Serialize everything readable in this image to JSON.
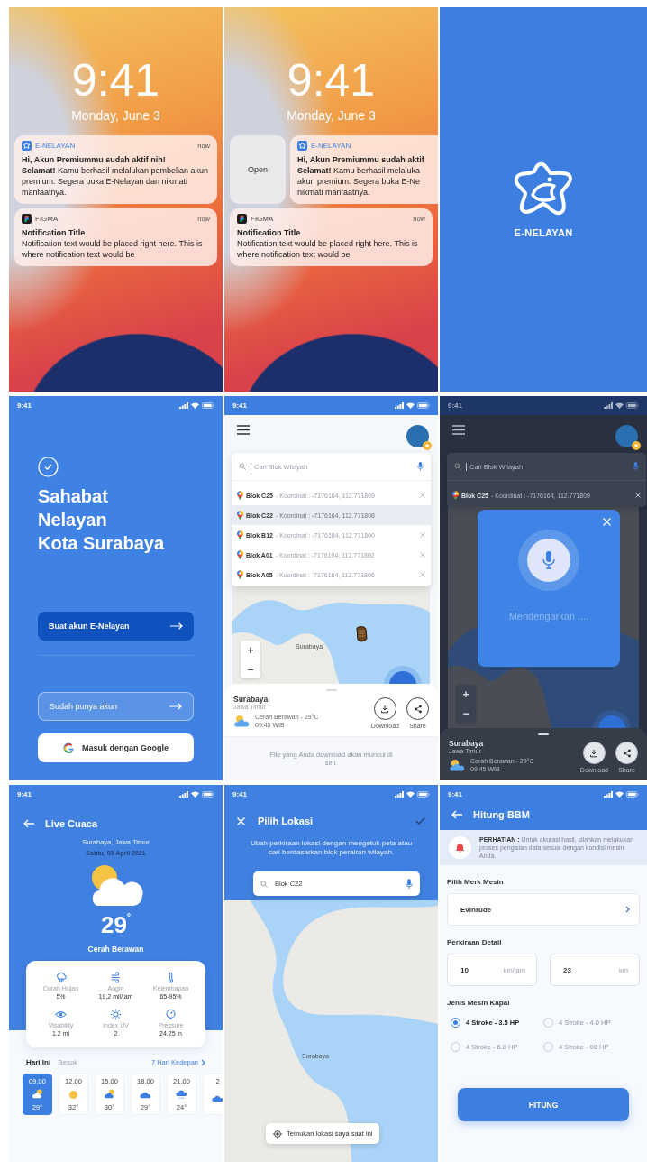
{
  "lock_screens": [
    {
      "time": "9:41",
      "date": "Monday, June 3",
      "notifications": [
        {
          "kind": "e-nelayan",
          "app": "E-NELAYAN",
          "time": "now",
          "title": "Hi, Akun Premiummu sudah aktif nih!",
          "body": "**Selamat!** Kamu berhasil melalukan pembelian akun premium. Segera buka E-Nelayan dan nikmati manfaatnya.",
          "swiped": false
        },
        {
          "kind": "figma",
          "app": "FIGMA",
          "time": "now",
          "title": "Notification Title",
          "body": "Notification text would be placed right here. This is where notification text would be",
          "swiped": false
        }
      ]
    },
    {
      "time": "9:41",
      "date": "Monday, June 3",
      "notifications": [
        {
          "kind": "e-nelayan",
          "app": "E-NELAYAN",
          "title": "Hi, Akun Premiummu sudah aktif",
          "body_lines": [
            "**Selamat!** Kamu berhasil melaluka",
            "akun premium. Segera buka E-Ne",
            "nikmati manfaatnya."
          ],
          "swiped": true,
          "action": "Open"
        },
        {
          "kind": "figma",
          "app": "FIGMA",
          "time": "now",
          "title": "Notification Title",
          "body": "Notification text would be placed right here. This is where notification text would be",
          "swiped": false
        }
      ]
    }
  ],
  "splash": {
    "brand": "E-NELAYAN"
  },
  "onboarding": {
    "time": "9:41",
    "title_lines": [
      "Sahabat",
      "Nelayan",
      "Kota Surabaya"
    ],
    "buttons": [
      {
        "kind": "primary",
        "label": "Buat akun E-Nelayan"
      },
      {
        "kind": "outline",
        "label": "Sudah punya akun"
      },
      {
        "kind": "google",
        "label": "Masuk dengan Google"
      }
    ]
  },
  "map_screen": {
    "time": "9:41",
    "search": {
      "placeholder": "Cari Blok Wilayah"
    },
    "results": [
      {
        "name": "Blok C25",
        "coords": "- Koordinat : -7176164, 112.771809",
        "selected": false
      },
      {
        "name": "Blok C22",
        "coords": "- Koordinat : -7176164, 112.771808",
        "selected": true
      },
      {
        "name": "Blok B12",
        "coords": "- Koordinat : -7176184, 112.771800",
        "selected": false
      },
      {
        "name": "Blok A01",
        "coords": "- Koordinat : -7176104, 112.771802",
        "selected": false
      },
      {
        "name": "Blok A05",
        "coords": "- Koordinat : -7176164, 112.771806",
        "selected": false
      }
    ],
    "map_labels": [
      "Surabaya"
    ],
    "zoom_controls": [
      "+",
      "−"
    ],
    "location": {
      "city": "Surabaya",
      "region": "Jawa Timur",
      "weather": "Cerah Berawan - 29°C",
      "time": "09.45 WIB"
    },
    "actions": [
      {
        "kind": "download",
        "label": "Download"
      },
      {
        "kind": "share",
        "label": "Share"
      }
    ],
    "note": "File yang Anda download akan muncul di sini."
  },
  "voice_screen": {
    "background": {
      "time": "9:41",
      "search": {
        "placeholder": "Cari Blok Wilayah"
      },
      "results": [
        {
          "name": "Blok C25",
          "coords": "- Koordinat : -7176164, 112.771809",
          "selected": false
        }
      ],
      "zoom_controls": [
        "+",
        "−"
      ],
      "location": {
        "city": "Surabaya",
        "region": "Jawa Timur",
        "weather": "Cerah Berawan - 29°C",
        "time": "09.45 WIB"
      },
      "actions": [
        {
          "kind": "download",
          "label": "Download"
        },
        {
          "kind": "share",
          "label": "Share"
        }
      ]
    },
    "modal": {
      "status": "Mendengarkan ...."
    }
  },
  "weather": {
    "time": "9:41",
    "title": "Live Cuaca",
    "location": "Surabaya, Jawa Timur",
    "date": "Sabtu, 03 April 2021",
    "temperature": "29",
    "degree": "°",
    "condition": "Cerah Berawan",
    "stats": [
      {
        "kind": "rain",
        "label": "Curah Hujan",
        "value": "5%"
      },
      {
        "kind": "wind",
        "label": "Angin",
        "value": "19,2 mil/jam"
      },
      {
        "kind": "humidity",
        "label": "Kelembapan",
        "value": "65-95%"
      },
      {
        "kind": "visibility",
        "label": "Visability",
        "value": "1.2 mi"
      },
      {
        "kind": "uv",
        "label": "Index UV",
        "value": "2"
      },
      {
        "kind": "pressure",
        "label": "Pressure",
        "value": "24.25 in"
      }
    ],
    "tabs": [
      {
        "label": "Hari Ini",
        "selected": true
      },
      {
        "label": "Besok",
        "selected": false
      }
    ],
    "more_link": "7 Hari Kedepan",
    "hourly": [
      {
        "time": "09.00",
        "kind": "partly-cloudy",
        "temp": "29°",
        "selected": true
      },
      {
        "time": "12.00",
        "kind": "sun",
        "temp": "32°",
        "selected": false
      },
      {
        "time": "15.00",
        "kind": "partly-cloudy",
        "temp": "30°",
        "selected": false
      },
      {
        "time": "18.00",
        "kind": "cloud",
        "temp": "29°",
        "selected": false
      },
      {
        "time": "21.00",
        "kind": "rain",
        "temp": "24°",
        "selected": false
      },
      {
        "time": "2",
        "kind": "cloud",
        "selected": false
      }
    ]
  },
  "pick_location": {
    "time": "9:41",
    "title": "Pilih Lokasi",
    "description": "Ubah perkiraan lokasi dengan mengetuk peta atau cari berdasarkan blok perairan wilayah.",
    "search": {
      "value": "Blok C22"
    },
    "map_labels": [
      "Surabaya"
    ],
    "locate_button": "Temukan lokasi saya saat ini"
  },
  "fuel": {
    "time": "9:41",
    "title": "Hitung BBM",
    "notice": "**PERHATIAN :** Untuk akurasi hasil, silahkan melakukan proses pengisian data sesuai dengan kondisi mesin Anda.",
    "brand_label": "Pilih Merk Mesin",
    "brand_value": "Evinrude",
    "detail_label": "Perkiraan Detail",
    "fields": [
      {
        "value": "10",
        "unit": "km/jam"
      },
      {
        "value": "23",
        "unit": "km"
      }
    ],
    "engine_label": "Jenis Mesin Kapal",
    "engines": [
      {
        "label": "4 Stroke - 3.5 HP",
        "selected": true
      },
      {
        "label": "4 Stroke - 4.0 HP",
        "selected": false
      },
      {
        "label": "4 Stroke - 6.0 HP",
        "selected": false
      },
      {
        "label": "4 Stroke - 98 HP",
        "selected": false
      }
    ],
    "submit": "HITUNG"
  }
}
